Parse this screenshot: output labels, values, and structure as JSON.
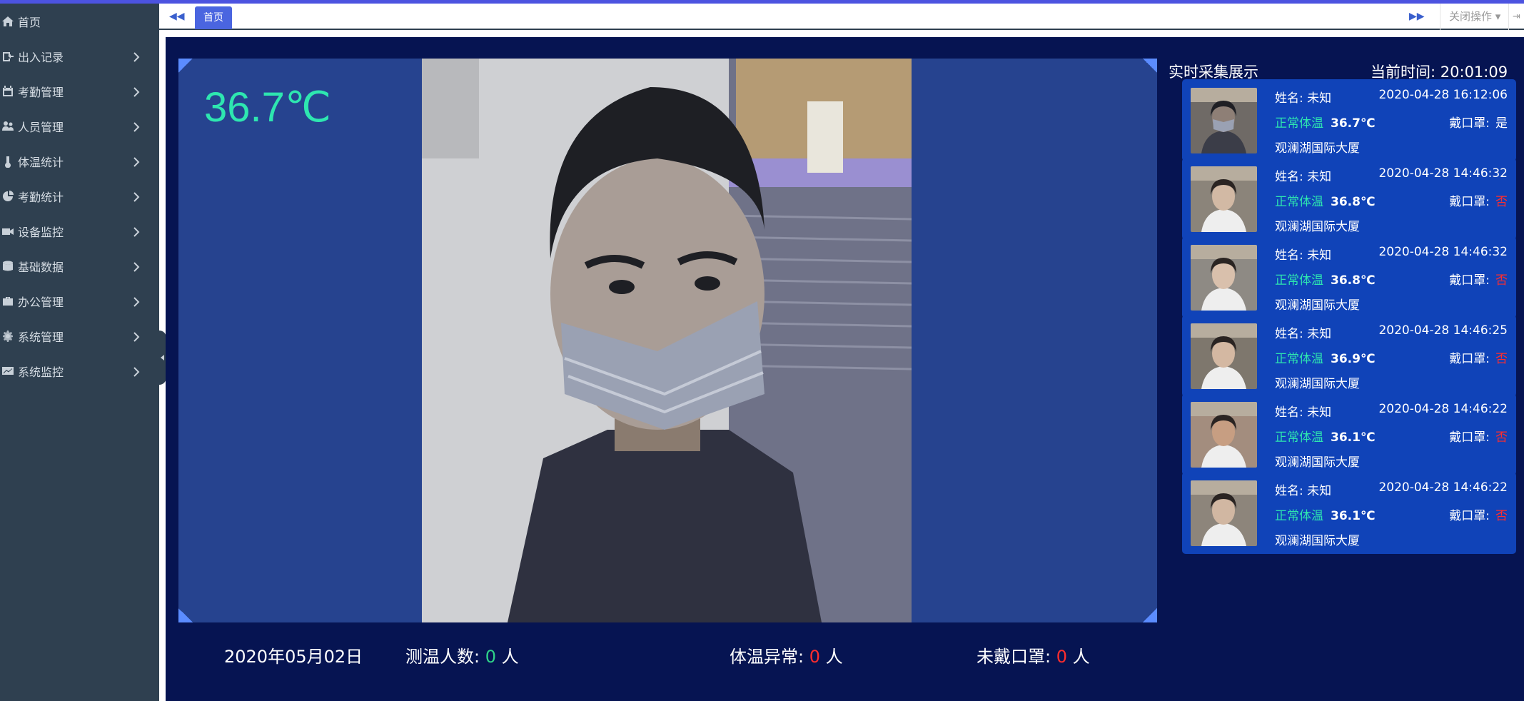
{
  "sidebar": {
    "items": [
      {
        "label": "首页",
        "icon": "home-icon",
        "has_children": false
      },
      {
        "label": "出入记录",
        "icon": "access-log-icon",
        "has_children": true
      },
      {
        "label": "考勤管理",
        "icon": "calendar-icon",
        "has_children": true
      },
      {
        "label": "人员管理",
        "icon": "users-icon",
        "has_children": true
      },
      {
        "label": "体温统计",
        "icon": "thermometer-icon",
        "has_children": true
      },
      {
        "label": "考勤统计",
        "icon": "pie-chart-icon",
        "has_children": true
      },
      {
        "label": "设备监控",
        "icon": "video-camera-icon",
        "has_children": true
      },
      {
        "label": "基础数据",
        "icon": "database-icon",
        "has_children": true
      },
      {
        "label": "办公管理",
        "icon": "briefcase-icon",
        "has_children": true
      },
      {
        "label": "系统管理",
        "icon": "settings-icon",
        "has_children": true
      },
      {
        "label": "系统监控",
        "icon": "monitor-chart-icon",
        "has_children": true
      }
    ]
  },
  "tabs": {
    "active_label": "首页",
    "close_ops_label": "关闭操作"
  },
  "monitor": {
    "live_temperature": "36.7℃",
    "date": "2020年05月02日",
    "measured_label": "测温人数:",
    "measured_count": "0",
    "abnormal_label": "体温异常:",
    "abnormal_count": "0",
    "no_mask_label": "未戴口罩:",
    "no_mask_count": "0",
    "unit": "人"
  },
  "realtime": {
    "title": "实时采集展示",
    "clock_label": "当前时间:",
    "clock_value": "20:01:09",
    "records": [
      {
        "name": "姓名: 未知",
        "datetime": "2020-04-28 16:12:06",
        "status": "正常体温",
        "temp": "36.7℃",
        "mask_label": "戴口罩:",
        "mask": "是",
        "mask_ok": true,
        "location": "观澜湖国际大厦"
      },
      {
        "name": "姓名: 未知",
        "datetime": "2020-04-28 14:46:32",
        "status": "正常体温",
        "temp": "36.8℃",
        "mask_label": "戴口罩:",
        "mask": "否",
        "mask_ok": false,
        "location": "观澜湖国际大厦"
      },
      {
        "name": "姓名: 未知",
        "datetime": "2020-04-28 14:46:32",
        "status": "正常体温",
        "temp": "36.8℃",
        "mask_label": "戴口罩:",
        "mask": "否",
        "mask_ok": false,
        "location": "观澜湖国际大厦"
      },
      {
        "name": "姓名: 未知",
        "datetime": "2020-04-28 14:46:25",
        "status": "正常体温",
        "temp": "36.9℃",
        "mask_label": "戴口罩:",
        "mask": "否",
        "mask_ok": false,
        "location": "观澜湖国际大厦"
      },
      {
        "name": "姓名: 未知",
        "datetime": "2020-04-28 14:46:22",
        "status": "正常体温",
        "temp": "36.1℃",
        "mask_label": "戴口罩:",
        "mask": "否",
        "mask_ok": false,
        "location": "观澜湖国际大厦"
      },
      {
        "name": "姓名: 未知",
        "datetime": "2020-04-28 14:46:22",
        "status": "正常体温",
        "temp": "36.1℃",
        "mask_label": "戴口罩:",
        "mask": "否",
        "mask_ok": false,
        "location": "观澜湖国际大厦"
      }
    ]
  },
  "colors": {
    "sidebar_bg": "#2f4050",
    "dashboard_bg": "#061452",
    "video_bg": "#26438f",
    "card_bg": "#1043b8",
    "accent_green": "#2ee6b0",
    "alert_red": "#ff2d2d",
    "tab_active": "#4a65e0"
  }
}
